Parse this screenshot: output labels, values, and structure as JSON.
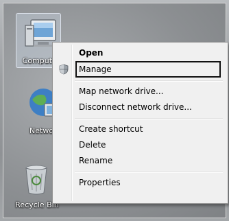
{
  "desktop": {
    "icons": [
      {
        "label": "Computer",
        "icon": "computer-icon"
      },
      {
        "label": "Network",
        "icon": "network-icon"
      },
      {
        "label": "Recycle Bin",
        "icon": "recycle-bin-icon"
      }
    ]
  },
  "context_menu": {
    "items": [
      {
        "label": "Open",
        "default": true
      },
      {
        "label": "Manage",
        "icon": "uac-shield-icon",
        "highlighted": true
      },
      {
        "label": "Map network drive..."
      },
      {
        "label": "Disconnect network drive..."
      },
      {
        "label": "Create shortcut"
      },
      {
        "label": "Delete"
      },
      {
        "label": "Rename"
      },
      {
        "label": "Properties"
      }
    ]
  }
}
